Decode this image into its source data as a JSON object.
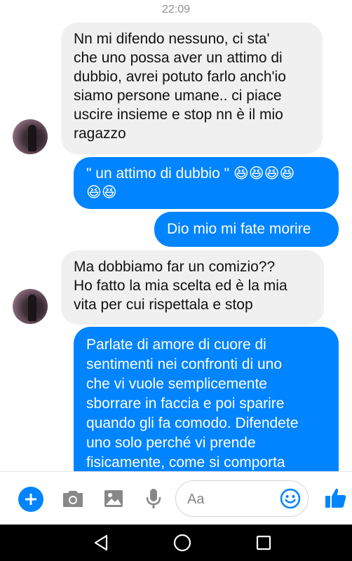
{
  "header": {
    "time": "22:09"
  },
  "messages": [
    {
      "side": "in",
      "text": "Nn mi difendo nessuno, ci sta'\nche uno possa aver un attimo di\ndubbio, avrei potuto farlo anch'io\nsiamo persone umane.. ci piace\nuscire insieme e stop nn è il mio\nragazzo"
    },
    {
      "side": "out",
      "text": "\" un attimo di dubbio \" 😆😆😆😆\n😆😆"
    },
    {
      "side": "out",
      "text": "Dio mio mi fate morire"
    },
    {
      "side": "in",
      "text": "Ma dobbiamo far un comizio??\nHo fatto la mia scelta ed è la mia\nvita per cui rispettala e stop"
    },
    {
      "side": "out",
      "text": "Parlate di amore di cuore di\nsentimenti nei confronti di uno\nche vi vuole semplicemente\nsborrare in faccia e poi sparire\nquando gli fa comodo. Difendete\nuno solo perché vi prende\nfisicamente, come si comporta"
    }
  ],
  "composer": {
    "placeholder": "Aa",
    "icons": [
      "plus-icon",
      "camera-icon",
      "image-icon",
      "microphone-icon",
      "emoji-icon",
      "thumbs-up-icon"
    ]
  },
  "colors": {
    "accent": "#0084ff",
    "incoming": "#f0f0f0",
    "navbar": "#000000"
  },
  "navigation": {
    "icons": [
      "back-icon",
      "home-icon",
      "recents-icon"
    ]
  }
}
